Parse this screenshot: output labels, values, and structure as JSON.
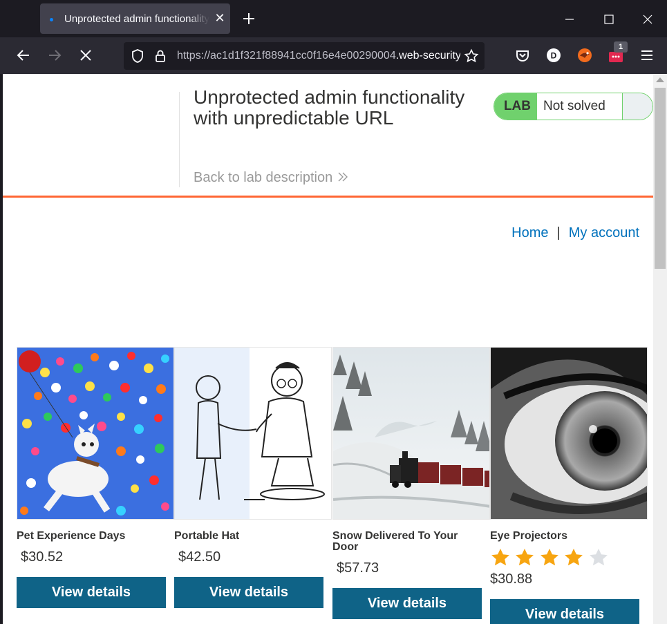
{
  "browser": {
    "tab_title": "Unprotected admin functionality with unpredictable URL",
    "url_prefix": "https://",
    "url_host": "ac1d1f321f88941cc0f16e4e00290004",
    "url_domain": ".web-security-academy.net/",
    "extension_badge": "1",
    "accent_color": "#0a84ff"
  },
  "header": {
    "title": "Unprotected admin functionality with unpredictable URL",
    "back_link": "Back to lab description",
    "status_lab": "LAB",
    "status_text": "Not solved",
    "accent_orange": "#ff6633",
    "status_green": "#70d16d"
  },
  "nav": {
    "home": "Home",
    "separator": "|",
    "my_account": "My account"
  },
  "products": [
    {
      "name": "Pet Experience Days",
      "price": "$30.52",
      "button": "View details",
      "rating": null
    },
    {
      "name": "Portable Hat",
      "price": "$42.50",
      "button": "View details",
      "rating": null
    },
    {
      "name": "Snow Delivered To Your Door",
      "price": "$57.73",
      "button": "View details",
      "rating": null
    },
    {
      "name": "Eye Projectors",
      "price": "$30.88",
      "button": "View details",
      "rating": 4,
      "rating_max": 5
    }
  ],
  "colors": {
    "button_bg": "#0f6387",
    "link": "#0071bc"
  }
}
